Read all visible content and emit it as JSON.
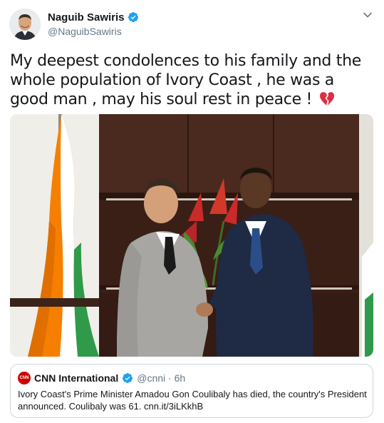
{
  "author": {
    "display_name": "Naguib Sawiris",
    "handle": "@NaguibSawiris",
    "verified_icon": "verified-badge-icon"
  },
  "tweet": {
    "text": "My deepest condolences to his family and the whole population of Ivory Coast , he was a good man , may his soul rest in peace ! ",
    "emoji": "broken-heart-icon"
  },
  "quoted_tweet": {
    "display_name": "CNN International",
    "handle_time": "@cnni · 6h",
    "avatar_text": "CNN",
    "text": "Ivory Coast's Prime Minister Amadou Gon Coulibaly has died, the country's President announced. Coulibaly was 61. cnn.it/3iLKkhB"
  },
  "colors": {
    "verified": "#1da1f2",
    "cnn_red": "#cc0000",
    "secondary_text": "#657786",
    "border": "#ccd6dd"
  }
}
